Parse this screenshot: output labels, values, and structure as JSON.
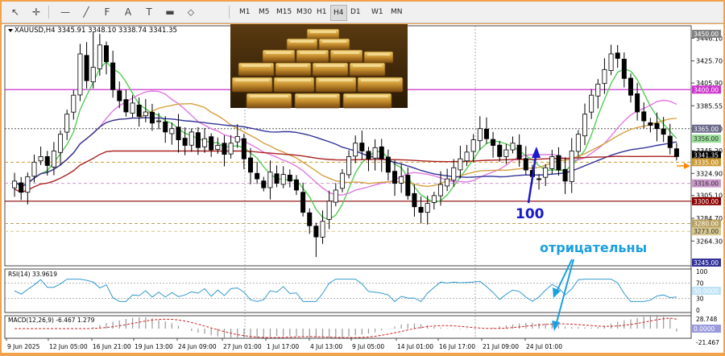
{
  "toolbar": {
    "tools": [
      {
        "icon": "cursor-icon",
        "glyph": "↖"
      },
      {
        "icon": "crosshair-icon",
        "glyph": "✛"
      },
      {
        "icon": "horizontal-line-icon",
        "glyph": "—"
      },
      {
        "icon": "trendline-icon",
        "glyph": "╱"
      },
      {
        "icon": "fibonacci-icon",
        "glyph": "F"
      },
      {
        "icon": "text-tool-icon",
        "glyph": "A"
      },
      {
        "icon": "text-label-icon",
        "glyph": "T"
      },
      {
        "icon": "rectangle-icon",
        "glyph": "▬"
      },
      {
        "icon": "shapes-icon",
        "glyph": "⬦"
      }
    ],
    "timeframes": [
      "M1",
      "M5",
      "M15",
      "M30",
      "H1",
      "H4",
      "D1",
      "W1",
      "MN"
    ],
    "active_timeframe": "H4"
  },
  "chart_data": {
    "type": "candlestick",
    "header": "XAUUSD,H4  3345.91 3348.10 3338.74 3341.35",
    "symbol": "XAUUSD",
    "timeframe": "H4",
    "ohlc": {
      "open": 3345.91,
      "high": 3348.1,
      "low": 3338.74,
      "close": 3341.35
    },
    "ylim": [
      3245,
      3450
    ],
    "price_ticks": [
      3446.1,
      3425.7,
      3405.9,
      3385.55,
      3365.0,
      3345.2,
      3324.9,
      3305.1,
      3284.7,
      3264.3
    ],
    "highlighted_levels": [
      {
        "price": 3450.0,
        "label": "3450.00",
        "color": "#808080"
      },
      {
        "price": 3400.0,
        "label": "3400.00",
        "color": "#cc33cc"
      },
      {
        "price": 3365.0,
        "label": "3365.00",
        "color": "#6a6a8a"
      },
      {
        "price": 3356.0,
        "label": "3356.00",
        "color": "#99dd99"
      },
      {
        "price": 3341.35,
        "label": "3341.35",
        "color": "#000000"
      },
      {
        "price": 3335.0,
        "label": "3335.00",
        "color": "#cc9933"
      },
      {
        "price": 3316.0,
        "label": "3316.00",
        "color": "#cc99cc"
      },
      {
        "price": 3300.0,
        "label": "3300.00",
        "color": "#8b0000"
      },
      {
        "price": 3280.0,
        "label": "3280.00",
        "color": "#b8a060"
      },
      {
        "price": 3273.0,
        "label": "3273.00",
        "color": "#d8c890"
      },
      {
        "price": 3245.0,
        "label": "3245.00",
        "color": "#333399"
      }
    ],
    "horizontal_lines": [
      {
        "price": 3400,
        "color": "#cc33cc",
        "style": "solid"
      },
      {
        "price": 3365,
        "color": "#555555",
        "style": "dotted"
      },
      {
        "price": 3335,
        "color": "#cc9933",
        "style": "dashed"
      },
      {
        "price": 3316,
        "color": "#cc99cc",
        "style": "dashed"
      },
      {
        "price": 3300,
        "color": "#8b0000",
        "style": "solid"
      },
      {
        "price": 3280,
        "color": "#b8a060",
        "style": "dashed"
      },
      {
        "price": 3273,
        "color": "#d8c890",
        "style": "dashed"
      }
    ],
    "x_labels": [
      "9 Jun 2025",
      "12 Jun 05:00",
      "16 Jun 21:00",
      "19 Jun 13:00",
      "24 Jun 09:00",
      "27 Jun 01:00",
      "1 Jul 17:00",
      "4 Jul 13:00",
      "9 Jul 05:00",
      "14 Jul 01:00",
      "16 Jul 17:00",
      "21 Jul 09:00",
      "24 Jul 01:00"
    ],
    "closes": [
      3318,
      3308,
      3322,
      3335,
      3340,
      3332,
      3345,
      3360,
      3378,
      3395,
      3432,
      3408,
      3420,
      3440,
      3425,
      3400,
      3390,
      3380,
      3388,
      3376,
      3380,
      3370,
      3372,
      3362,
      3365,
      3355,
      3350,
      3362,
      3348,
      3356,
      3346,
      3350,
      3342,
      3352,
      3358,
      3338,
      3326,
      3320,
      3312,
      3326,
      3316,
      3324,
      3318,
      3310,
      3290,
      3278,
      3268,
      3282,
      3300,
      3310,
      3325,
      3340,
      3352,
      3345,
      3338,
      3348,
      3338,
      3326,
      3316,
      3322,
      3305,
      3295,
      3290,
      3298,
      3305,
      3315,
      3320,
      3330,
      3338,
      3344,
      3355,
      3365,
      3356,
      3350,
      3340,
      3346,
      3352,
      3338,
      3328,
      3322,
      3320,
      3330,
      3340,
      3328,
      3318,
      3345,
      3360,
      3378,
      3395,
      3405,
      3418,
      3432,
      3428,
      3410,
      3395,
      3380,
      3372,
      3368,
      3365,
      3360,
      3348,
      3340
    ],
    "moving_averages": [
      {
        "color": "#55cc55",
        "period": "fast"
      },
      {
        "color": "#e07ae0",
        "period": "medium"
      },
      {
        "color": "#d4a040",
        "period": "medium"
      },
      {
        "color": "#333399",
        "period": "slow"
      },
      {
        "color": "#aa2222",
        "period": "slowest"
      }
    ],
    "rsi": {
      "label": "RSI(14) 33.9619",
      "levels": [
        100,
        70,
        30,
        0
      ],
      "current": 33.9619,
      "color": "#3399cc",
      "highlight_label": "50.0000"
    },
    "macd": {
      "label": "MACD(12,26,9) -6.467 1.279",
      "macd": -6.467,
      "signal": 1.279,
      "scale_top": "28.748",
      "scale_mid": "0.0000",
      "scale_bottom": "-21.467"
    },
    "annotations": {
      "ma_label": "100",
      "text": "отрицательны"
    },
    "colors": {
      "bull": "#000000",
      "bear": "#000000",
      "frame": "#f2a24a",
      "arrow_blue": "#1a1acc",
      "text_cyan": "#1a9fe0",
      "arrow_orange": "#ff8800"
    }
  },
  "image": {
    "icon": "gold-bars-image"
  }
}
